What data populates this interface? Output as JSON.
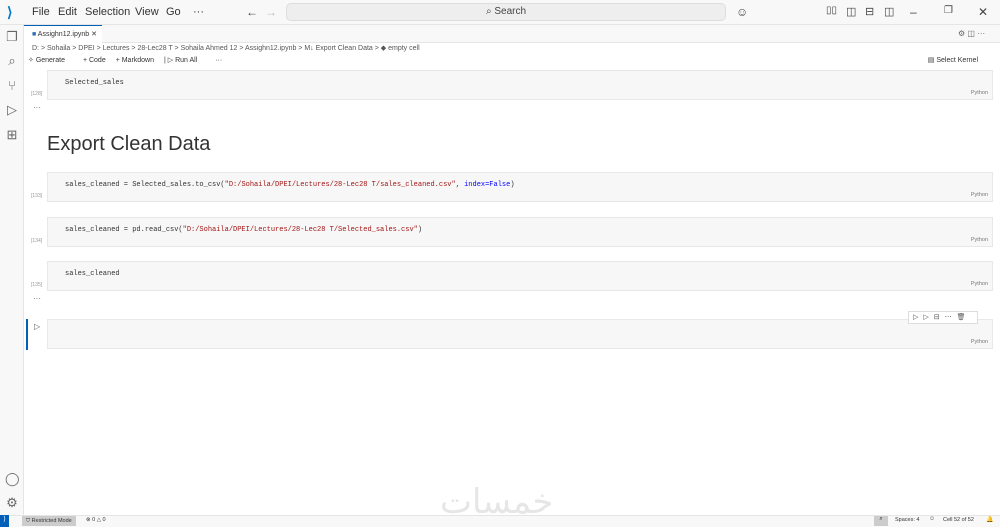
{
  "menu": [
    "File",
    "Edit",
    "Selection",
    "View",
    "Go",
    "···"
  ],
  "search": "Search",
  "tab": {
    "label": "Assighn12.ipynb"
  },
  "breadcrumbs": "D: > Sohaila > DPEI > Lectures > 28-Lec28 T > Sohaila Ahmed 12 > Assighn12.ipynb > M↓ Export Clean Data > ◆ empty cell",
  "toolbar": {
    "generate": "Generate",
    "code": "+ Code",
    "markdown": "+ Markdown",
    "run_all": "Run All",
    "more": "···",
    "kernel": "Select Kernel"
  },
  "cells": [
    {
      "count": "[128]",
      "code": "Selected_sales",
      "lang": "Python"
    },
    {
      "count": "[133]",
      "code_a": "sales_cleaned = Selected_sales.to_csv(",
      "code_str": "\"D:/Sohaila/DPEI/Lectures/28-Lec28 T/sales_cleaned.csv\"",
      "code_b": ", ",
      "code_kw": "index=False",
      "code_c": ")",
      "lang": "Python"
    },
    {
      "count": "[134]",
      "code_a": "sales_cleaned = pd.read_csv(",
      "code_str": "\"D:/Sohaila/DPEI/Lectures/28-Lec28 T/Selected_sales.csv\"",
      "code_c": ")",
      "lang": "Python"
    },
    {
      "count": "[135]",
      "code": "sales_cleaned",
      "lang": "Python"
    },
    {
      "count": "",
      "code": "",
      "lang": "Python"
    }
  ],
  "ellipsis": "···",
  "heading": "Export Clean Data",
  "status": {
    "restricted": "Restricted Mode",
    "problems": "⊗ 0 △ 0",
    "spaces": "Spaces: 4",
    "cell": "Cell 52 of 52"
  },
  "watermark": "خمسات"
}
